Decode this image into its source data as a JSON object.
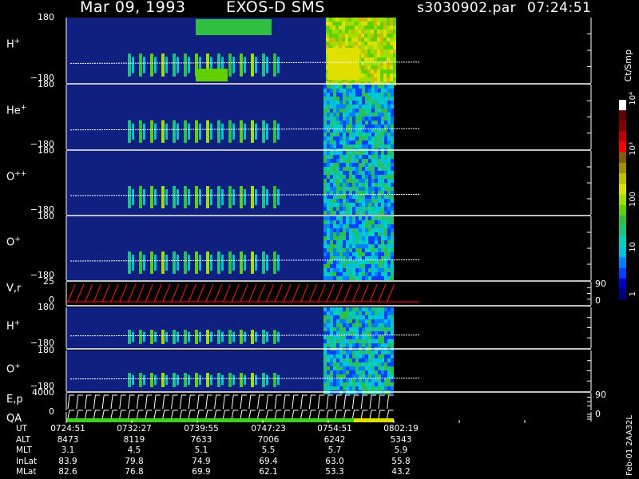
{
  "header": {
    "date": "Mar 09, 1993",
    "mission": "EXOS-D SMS",
    "file": "s3030902.par",
    "time": "07:24:51"
  },
  "colorbar": {
    "unit": "Ct/Smp",
    "ticks": [
      "1",
      "10",
      "100",
      "10³",
      "10⁴"
    ],
    "colors": [
      "#000080",
      "#0000c0",
      "#0040ff",
      "#0080ff",
      "#00c0e0",
      "#00d0c0",
      "#20c080",
      "#30c040",
      "#60d000",
      "#a0e000",
      "#e0e000",
      "#c0c000",
      "#a09000",
      "#806000",
      "#ff0000",
      "#c00000",
      "#800000",
      "#600000",
      "#ffffff"
    ]
  },
  "panels": [
    {
      "label": "H",
      "sup": "+",
      "top": "180",
      "bottom": "−180"
    },
    {
      "label": "He",
      "sup": "+",
      "top": "180",
      "bottom": "−180"
    },
    {
      "label": "O",
      "sup": "++",
      "top": "180",
      "bottom": "−180"
    },
    {
      "label": "O",
      "sup": "+",
      "top": "180",
      "bottom": "−180"
    },
    {
      "label": "V,r",
      "sup": "",
      "top": "25",
      "bottom": "0",
      "right_top": "90",
      "right_bottom": "0"
    },
    {
      "label": "H",
      "sup": "+",
      "top": "180",
      "bottom": "−180"
    },
    {
      "label": "O",
      "sup": "+",
      "top": "180",
      "bottom": "−180"
    },
    {
      "label": "E,p",
      "sup": "",
      "top": "4000",
      "bottom": "",
      "right_top": "90",
      "right_bottom": ""
    },
    {
      "label": "QA",
      "sup": "",
      "top": "0",
      "bottom": "",
      "right_top": "0",
      "right_bottom": ""
    }
  ],
  "footer_code": "Feb-01 2AA32L",
  "chart_data": {
    "type": "heatmap",
    "title": "Mar 09, 1993   EXOS-D SMS",
    "x_label": "UT",
    "rows": [
      "UT",
      "ALT",
      "MLT",
      "InLat",
      "MLat"
    ],
    "columns": [
      {
        "UT": "0724:51",
        "ALT": "8473",
        "MLT": "3.1",
        "InLat": "83.9",
        "MLat": "82.6"
      },
      {
        "UT": "0732:27",
        "ALT": "8119",
        "MLT": "4.5",
        "InLat": "79.8",
        "MLat": "76.8"
      },
      {
        "UT": "0739:55",
        "ALT": "7633",
        "MLT": "5.1",
        "InLat": "74.9",
        "MLat": "69.9"
      },
      {
        "UT": "0747:23",
        "ALT": "7006",
        "MLT": "5.5",
        "InLat": "69.4",
        "MLat": "62.1"
      },
      {
        "UT": "0754:51",
        "ALT": "6242",
        "MLT": "5.7",
        "InLat": "63.0",
        "MLat": "53.3"
      },
      {
        "UT": "0802:19",
        "ALT": "5343",
        "MLT": "5.9",
        "InLat": "55.8",
        "MLat": "43.2"
      }
    ],
    "y_range_pitch": [
      -180,
      180
    ],
    "vr_range": [
      0,
      25
    ],
    "ep_range": [
      0,
      4000
    ],
    "colorbar_range": [
      1,
      10000
    ],
    "colorbar_scale": "log"
  }
}
